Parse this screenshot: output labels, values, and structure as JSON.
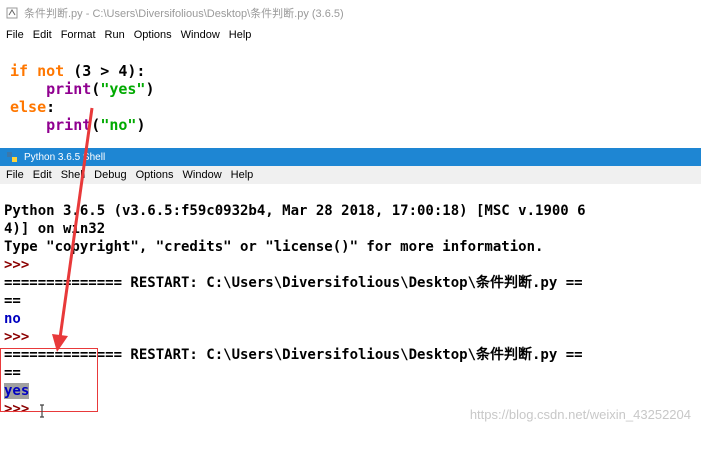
{
  "editor": {
    "title": "条件判断.py - C:\\Users\\Diversifolious\\Desktop\\条件判断.py (3.6.5)",
    "menu": [
      "File",
      "Edit",
      "Format",
      "Run",
      "Options",
      "Window",
      "Help"
    ],
    "code": {
      "l1_kw": "if not",
      "l1_rest": " (3 > 4):",
      "l2_fn": "print",
      "l2_open": "(",
      "l2_str": "\"yes\"",
      "l2_close": ")",
      "l3_kw": "else",
      "l3_rest": ":",
      "l4_fn": "print",
      "l4_open": "(",
      "l4_str": "\"no\"",
      "l4_close": ")"
    }
  },
  "shell": {
    "title": "Python 3.6.5 Shell",
    "menu": [
      "File",
      "Edit",
      "Shell",
      "Debug",
      "Options",
      "Window",
      "Help"
    ],
    "lines": {
      "banner1": "Python 3.6.5 (v3.6.5:f59c0932b4, Mar 28 2018, 17:00:18) [MSC v.1900 6",
      "banner2": "4)] on win32",
      "banner3": "Type \"copyright\", \"credits\" or \"license()\" for more information.",
      "prompt": ">>>",
      "restart": "============== RESTART: C:\\Users\\Diversifolious\\Desktop\\条件判断.py ==",
      "eq": "==",
      "out_no": "no",
      "out_yes": "yes"
    }
  },
  "watermark": "https://blog.csdn.net/weixin_43252204"
}
